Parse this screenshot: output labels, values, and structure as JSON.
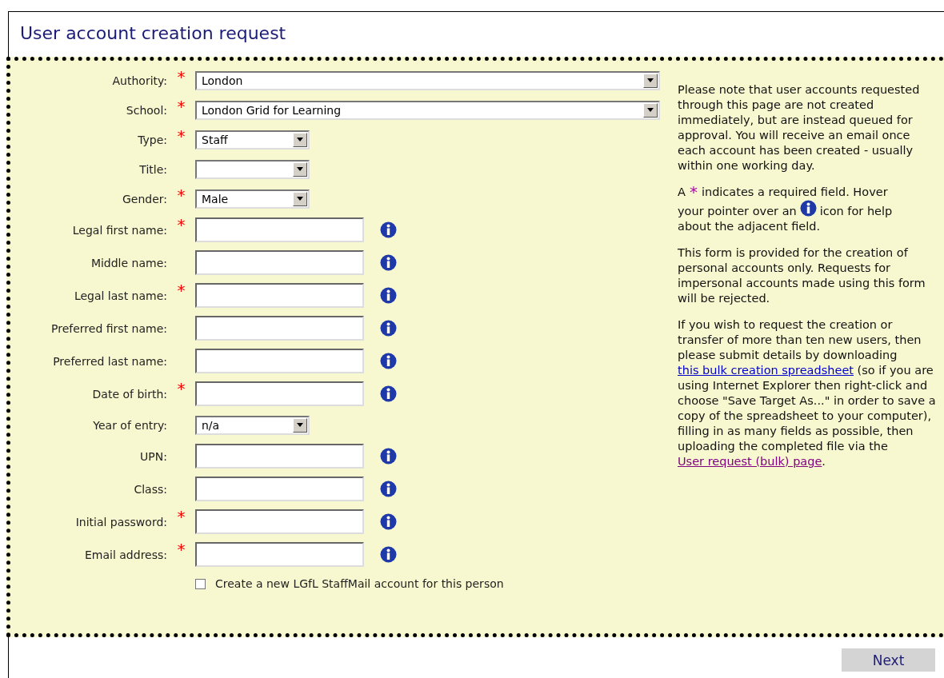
{
  "title": "User account creation request",
  "fields": [
    {
      "label": "Authority:",
      "required": true,
      "kind": "combo",
      "value": "London",
      "info": false
    },
    {
      "label": "School:",
      "required": true,
      "kind": "combo",
      "value": "London Grid for Learning",
      "info": false
    },
    {
      "label": "Type:",
      "required": true,
      "kind": "dropdown",
      "value": "Staff",
      "info": false
    },
    {
      "label": "Title:",
      "required": false,
      "kind": "dropdown",
      "info": false
    },
    {
      "label": "Gender:",
      "required": true,
      "kind": "dropdown",
      "value": "Male",
      "info": false
    },
    {
      "label": "Legal first name:",
      "required": true,
      "kind": "text",
      "info": true
    },
    {
      "label": "Middle name:",
      "required": false,
      "kind": "text",
      "info": true
    },
    {
      "label": "Legal last name:",
      "required": true,
      "kind": "text",
      "info": true
    },
    {
      "label": "Preferred first name:",
      "required": false,
      "kind": "text",
      "info": true
    },
    {
      "label": "Preferred last name:",
      "required": false,
      "kind": "text",
      "info": true
    },
    {
      "label": "Date of birth:",
      "required": true,
      "kind": "text",
      "info": true
    },
    {
      "label": "Year of entry:",
      "required": false,
      "kind": "dropdown",
      "value": "n/a",
      "info": false
    },
    {
      "label": "UPN:",
      "required": false,
      "kind": "text",
      "info": true
    },
    {
      "label": "Class:",
      "required": false,
      "kind": "text",
      "info": true
    },
    {
      "label": "Initial password:",
      "required": true,
      "kind": "text",
      "info": true
    },
    {
      "label": "Email address:",
      "required": true,
      "kind": "text",
      "info": true
    }
  ],
  "required_mark": "*",
  "staffmail": {
    "label": "Create a new LGfL StaffMail account for this person",
    "checked": false
  },
  "notes": {
    "intro": "Please note that user accounts requested through this page are not created immediately, but are instead queued for approval. You will receive an email once each account has been created - usually within one working day.",
    "legend_a": "A",
    "legend_mark": "*",
    "legend_b": "indicates a required field. Hover",
    "legend_c": "your pointer over an",
    "legend_d": "icon for help",
    "legend_e": "about the adjacent field.",
    "personal": "This form is provided for the creation of personal accounts only. Requests for impersonal accounts made using this form will be rejected.",
    "bulk_a": "If you wish to request the creation or transfer of more than ten new users, then please submit details by downloading",
    "bulk_link": "this bulk creation spreadsheet",
    "bulk_b": "(so if you are using Internet Explorer then right-click and choose \"Save Target As...\" in order to save a copy of the spreadsheet to your computer), filling in as many fields as possible, then uploading the completed file via the",
    "bulk_link2": "User request (bulk) page",
    "bulk_c": "."
  },
  "next_button": "Next"
}
